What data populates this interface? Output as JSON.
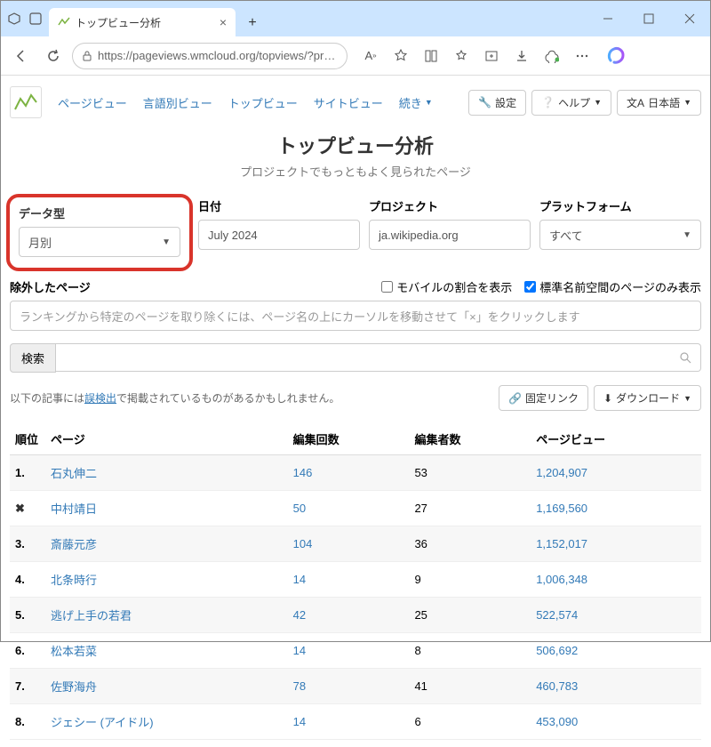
{
  "browser": {
    "tab_title": "トップビュー分析",
    "url": "https://pageviews.wmcloud.org/topviews/?proje..."
  },
  "nav": {
    "links": [
      "ページビュー",
      "言語別ビュー",
      "トップビュー",
      "サイトビュー"
    ],
    "more": "続き",
    "settings": "設定",
    "help": "ヘルプ",
    "language": "日本語"
  },
  "hero": {
    "title": "トップビュー分析",
    "subtitle": "プロジェクトでもっともよく見られたページ"
  },
  "filters": {
    "data_type_label": "データ型",
    "data_type_value": "月別",
    "date_label": "日付",
    "date_value": "July 2024",
    "project_label": "プロジェクト",
    "project_value": "ja.wikipedia.org",
    "platform_label": "プラットフォーム",
    "platform_value": "すべて"
  },
  "excluded": {
    "label": "除外したページ",
    "mobile_ratio": "モバイルの割合を表示",
    "mainspace_only": "標準名前空間のページのみ表示",
    "placeholder": "ランキングから特定のページを取り除くには、ページ名の上にカーソルを移動させて「×」をクリックします"
  },
  "search": {
    "label": "検索"
  },
  "note": {
    "prefix": "以下の記事には",
    "link": "誤検出",
    "suffix": "で掲載されているものがあるかもしれません。",
    "permalink": "固定リンク",
    "download": "ダウンロード"
  },
  "table": {
    "headers": {
      "rank": "順位",
      "page": "ページ",
      "edits": "編集回数",
      "editors": "編集者数",
      "views": "ページビュー"
    },
    "rows": [
      {
        "rank": "1.",
        "page": "石丸伸二",
        "edits": "146",
        "editors": "53",
        "views": "1,204,907",
        "excluded": false
      },
      {
        "rank": "",
        "page": "中村靖日",
        "edits": "50",
        "editors": "27",
        "views": "1,169,560",
        "excluded": true
      },
      {
        "rank": "3.",
        "page": "斎藤元彦",
        "edits": "104",
        "editors": "36",
        "views": "1,152,017",
        "excluded": false
      },
      {
        "rank": "4.",
        "page": "北条時行",
        "edits": "14",
        "editors": "9",
        "views": "1,006,348",
        "excluded": false
      },
      {
        "rank": "5.",
        "page": "逃げ上手の若君",
        "edits": "42",
        "editors": "25",
        "views": "522,574",
        "excluded": false
      },
      {
        "rank": "6.",
        "page": "松本若菜",
        "edits": "14",
        "editors": "8",
        "views": "506,692",
        "excluded": false
      },
      {
        "rank": "7.",
        "page": "佐野海舟",
        "edits": "78",
        "editors": "41",
        "views": "460,783",
        "excluded": false
      },
      {
        "rank": "8.",
        "page": "ジェシー (アイドル)",
        "edits": "14",
        "editors": "6",
        "views": "453,090",
        "excluded": false
      }
    ]
  }
}
